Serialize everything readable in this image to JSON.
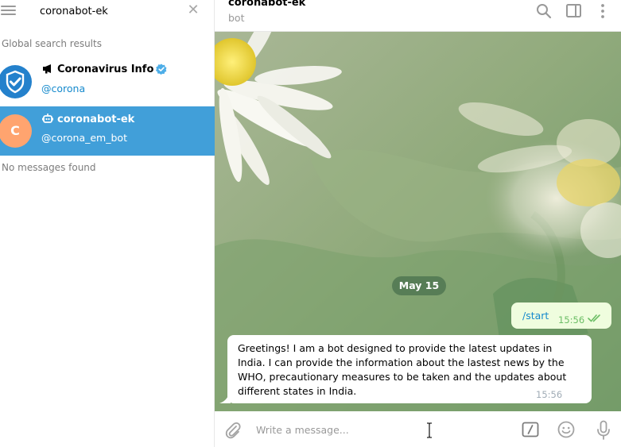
{
  "search": {
    "query": "coronabot-ek",
    "global_results_label": "Global search results",
    "no_messages_label": "No messages found"
  },
  "results": [
    {
      "name": "Coronavirus Info",
      "handle": "@corona",
      "verified": true,
      "type": "channel",
      "icon": "megaphone-icon"
    },
    {
      "name": "coronabot-ek",
      "handle": "@corona_em_bot",
      "avatar_letter": "C",
      "type": "bot",
      "icon": "bot-icon",
      "selected": true
    }
  ],
  "chat": {
    "title": "coronabot-ek",
    "subtitle": "bot",
    "date_label": "May 15",
    "messages": [
      {
        "direction": "out",
        "text": "/start",
        "time": "15:56",
        "status": "read"
      },
      {
        "direction": "in",
        "text": "Greetings! I am a bot designed to provide the latest updates in India. I can provide the information about the lastest news by the WHO, precautionary measures to be taken and the updates about different states in India.",
        "time": "15:56"
      }
    ]
  },
  "composer": {
    "placeholder": "Write a message..."
  },
  "colors": {
    "accent": "#419fd9",
    "link": "#168acd",
    "outgoing_bubble": "#effdde",
    "read_ticks": "#6cbe66",
    "bot_avatar": "#ffa46f"
  }
}
